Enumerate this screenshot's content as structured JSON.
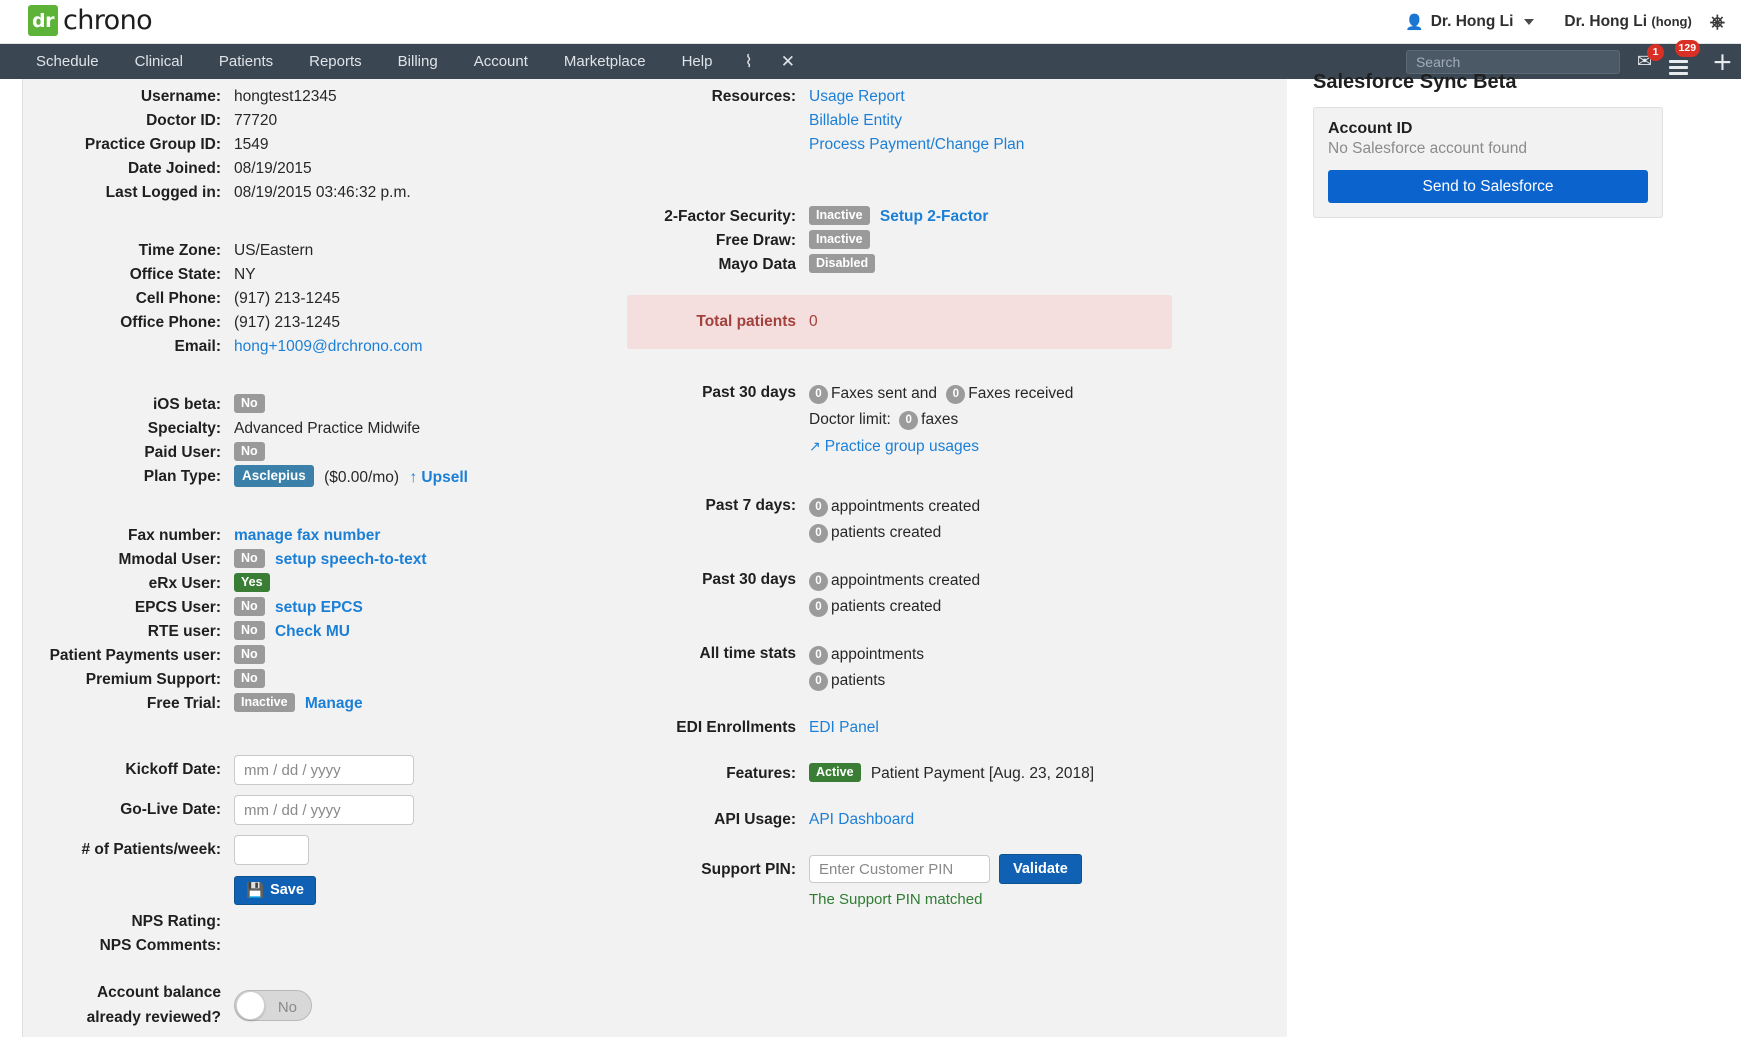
{
  "brand": {
    "logo_badge": "dr",
    "logo_word": "chrono",
    "user_menu": "Dr. Hong Li",
    "user_name": "Dr. Hong Li",
    "user_handle": "(hong)",
    "person_icon": "person-icon",
    "power_icon": "power-icon"
  },
  "nav": {
    "items": [
      {
        "label": "Schedule"
      },
      {
        "label": "Clinical"
      },
      {
        "label": "Patients"
      },
      {
        "label": "Reports"
      },
      {
        "label": "Billing"
      },
      {
        "label": "Account"
      },
      {
        "label": "Marketplace"
      },
      {
        "label": "Help"
      }
    ],
    "icon_vertical": "⌇",
    "icon_x": "✕",
    "search_placeholder": "Search",
    "search_value": "",
    "mail_badge": "1",
    "menu_badge": "129"
  },
  "account": {
    "username_label": "Username:",
    "username": "hongtest12345",
    "doctor_id_label": "Doctor ID:",
    "doctor_id": "77720",
    "practice_group_id_label": "Practice Group ID:",
    "practice_group_id": "1549",
    "date_joined_label": "Date Joined:",
    "date_joined": "08/19/2015",
    "last_logged_in_label": "Last Logged in:",
    "last_logged_in": "08/19/2015 03:46:32 p.m.",
    "time_zone_label": "Time Zone:",
    "time_zone": "US/Eastern",
    "office_state_label": "Office State:",
    "office_state": "NY",
    "cell_phone_label": "Cell Phone:",
    "cell_phone": "(917) 213-1245",
    "office_phone_label": "Office Phone:",
    "office_phone": "(917) 213-1245",
    "email_label": "Email:",
    "email": "hong+1009@drchrono.com",
    "ios_beta_label": "iOS beta:",
    "ios_beta": "No",
    "specialty_label": "Specialty:",
    "specialty": "Advanced Practice Midwife",
    "paid_user_label": "Paid User:",
    "paid_user": "No",
    "plan_type_label": "Plan Type:",
    "plan_type": "Asclepius",
    "plan_price": "($0.00/mo)",
    "upsell_label": "Upsell",
    "fax_number_label": "Fax number:",
    "manage_fax_label": "manage fax number",
    "mmodal_label": "Mmodal User:",
    "mmodal_value": "No",
    "mmodal_link": "setup speech-to-text",
    "erx_label": "eRx User:",
    "erx_value": "Yes",
    "epcs_label": "EPCS User:",
    "epcs_value": "No",
    "epcs_link": "setup EPCS",
    "rte_label": "RTE user:",
    "rte_value": "No",
    "rte_link": "Check MU",
    "patient_payments_label": "Patient Payments user:",
    "patient_payments_value": "No",
    "premium_support_label": "Premium Support:",
    "premium_support_value": "No",
    "free_trial_label": "Free Trial:",
    "free_trial_value": "Inactive",
    "free_trial_link": "Manage",
    "kickoff_date_label": "Kickoff Date:",
    "kickoff_date_value": "",
    "kickoff_date_placeholder": "mm / dd / yyyy",
    "golive_date_label": "Go-Live Date:",
    "golive_date_value": "",
    "golive_date_placeholder": "mm / dd / yyyy",
    "patients_week_label": "# of Patients/week:",
    "patients_week_value": "",
    "save_label": "Save",
    "save_icon": "floppy-disk-icon",
    "nps_rating_label": "NPS Rating:",
    "nps_rating_value": "",
    "nps_comments_label": "NPS Comments:",
    "nps_comments_value": "",
    "balance_reviewed_label_l1": "Account balance",
    "balance_reviewed_label_l2": "already reviewed?",
    "balance_reviewed_value": "No"
  },
  "right": {
    "resources_label": "Resources:",
    "resources": [
      "Usage Report",
      "Billable Entity",
      "Process Payment/Change Plan"
    ],
    "two_factor_label": "2-Factor Security:",
    "two_factor_value": "Inactive",
    "two_factor_link": "Setup 2-Factor",
    "free_draw_label": "Free Draw:",
    "free_draw_value": "Inactive",
    "mayo_label": "Mayo Data",
    "mayo_value": "Disabled",
    "total_patients_label": "Total patients",
    "total_patients_value": "0",
    "fax_section_label": "Past 30 days",
    "faxes_sent": "0",
    "faxes_sent_text": "Faxes sent and",
    "faxes_received": "0",
    "faxes_received_text": "Faxes received",
    "doctor_limit_text": "Doctor limit:",
    "doctor_limit": "0",
    "doctor_limit_unit": "faxes",
    "practice_group_usages": "Practice group usages",
    "external_link_icon": "external-link-icon",
    "past7_label": "Past 7 days:",
    "past7_appts": "0",
    "past7_appts_text": "appointments created",
    "past7_patients": "0",
    "past7_patients_text": "patients created",
    "past30_label": "Past 30 days",
    "past30_appts": "0",
    "past30_appts_text": "appointments created",
    "past30_patients": "0",
    "past30_patients_text": "patients created",
    "alltime_label": "All time stats",
    "alltime_appts": "0",
    "alltime_appts_text": "appointments",
    "alltime_patients": "0",
    "alltime_patients_text": "patients",
    "edi_label": "EDI Enrollments",
    "edi_link": "EDI Panel",
    "features_label": "Features:",
    "features_badge": "Active",
    "features_text": "Patient Payment [Aug. 23, 2018]",
    "api_label": "API Usage:",
    "api_link": "API Dashboard",
    "support_pin_label": "Support PIN:",
    "support_pin_value": "",
    "support_pin_placeholder": "Enter Customer PIN",
    "validate_label": "Validate",
    "pin_matched": "The Support PIN matched"
  },
  "salesforce": {
    "title": "Salesforce Sync Beta",
    "account_id_label": "Account ID",
    "account_id_value": "No Salesforce account found",
    "send_label": "Send to Salesforce"
  },
  "colors": {
    "nav_bg": "#3a4652",
    "link": "#1c7fd6",
    "badge_gray": "#9a9a9a",
    "badge_green": "#3a7d34",
    "badge_blue": "#3b80a8",
    "alert_pink_bg": "#f4dede",
    "alert_pink_fg": "#a3413c",
    "primary_btn": "#1061b4",
    "salesforce_btn": "#0b63ce",
    "logo_green": "#5cb338",
    "badge_red": "#d93025"
  }
}
